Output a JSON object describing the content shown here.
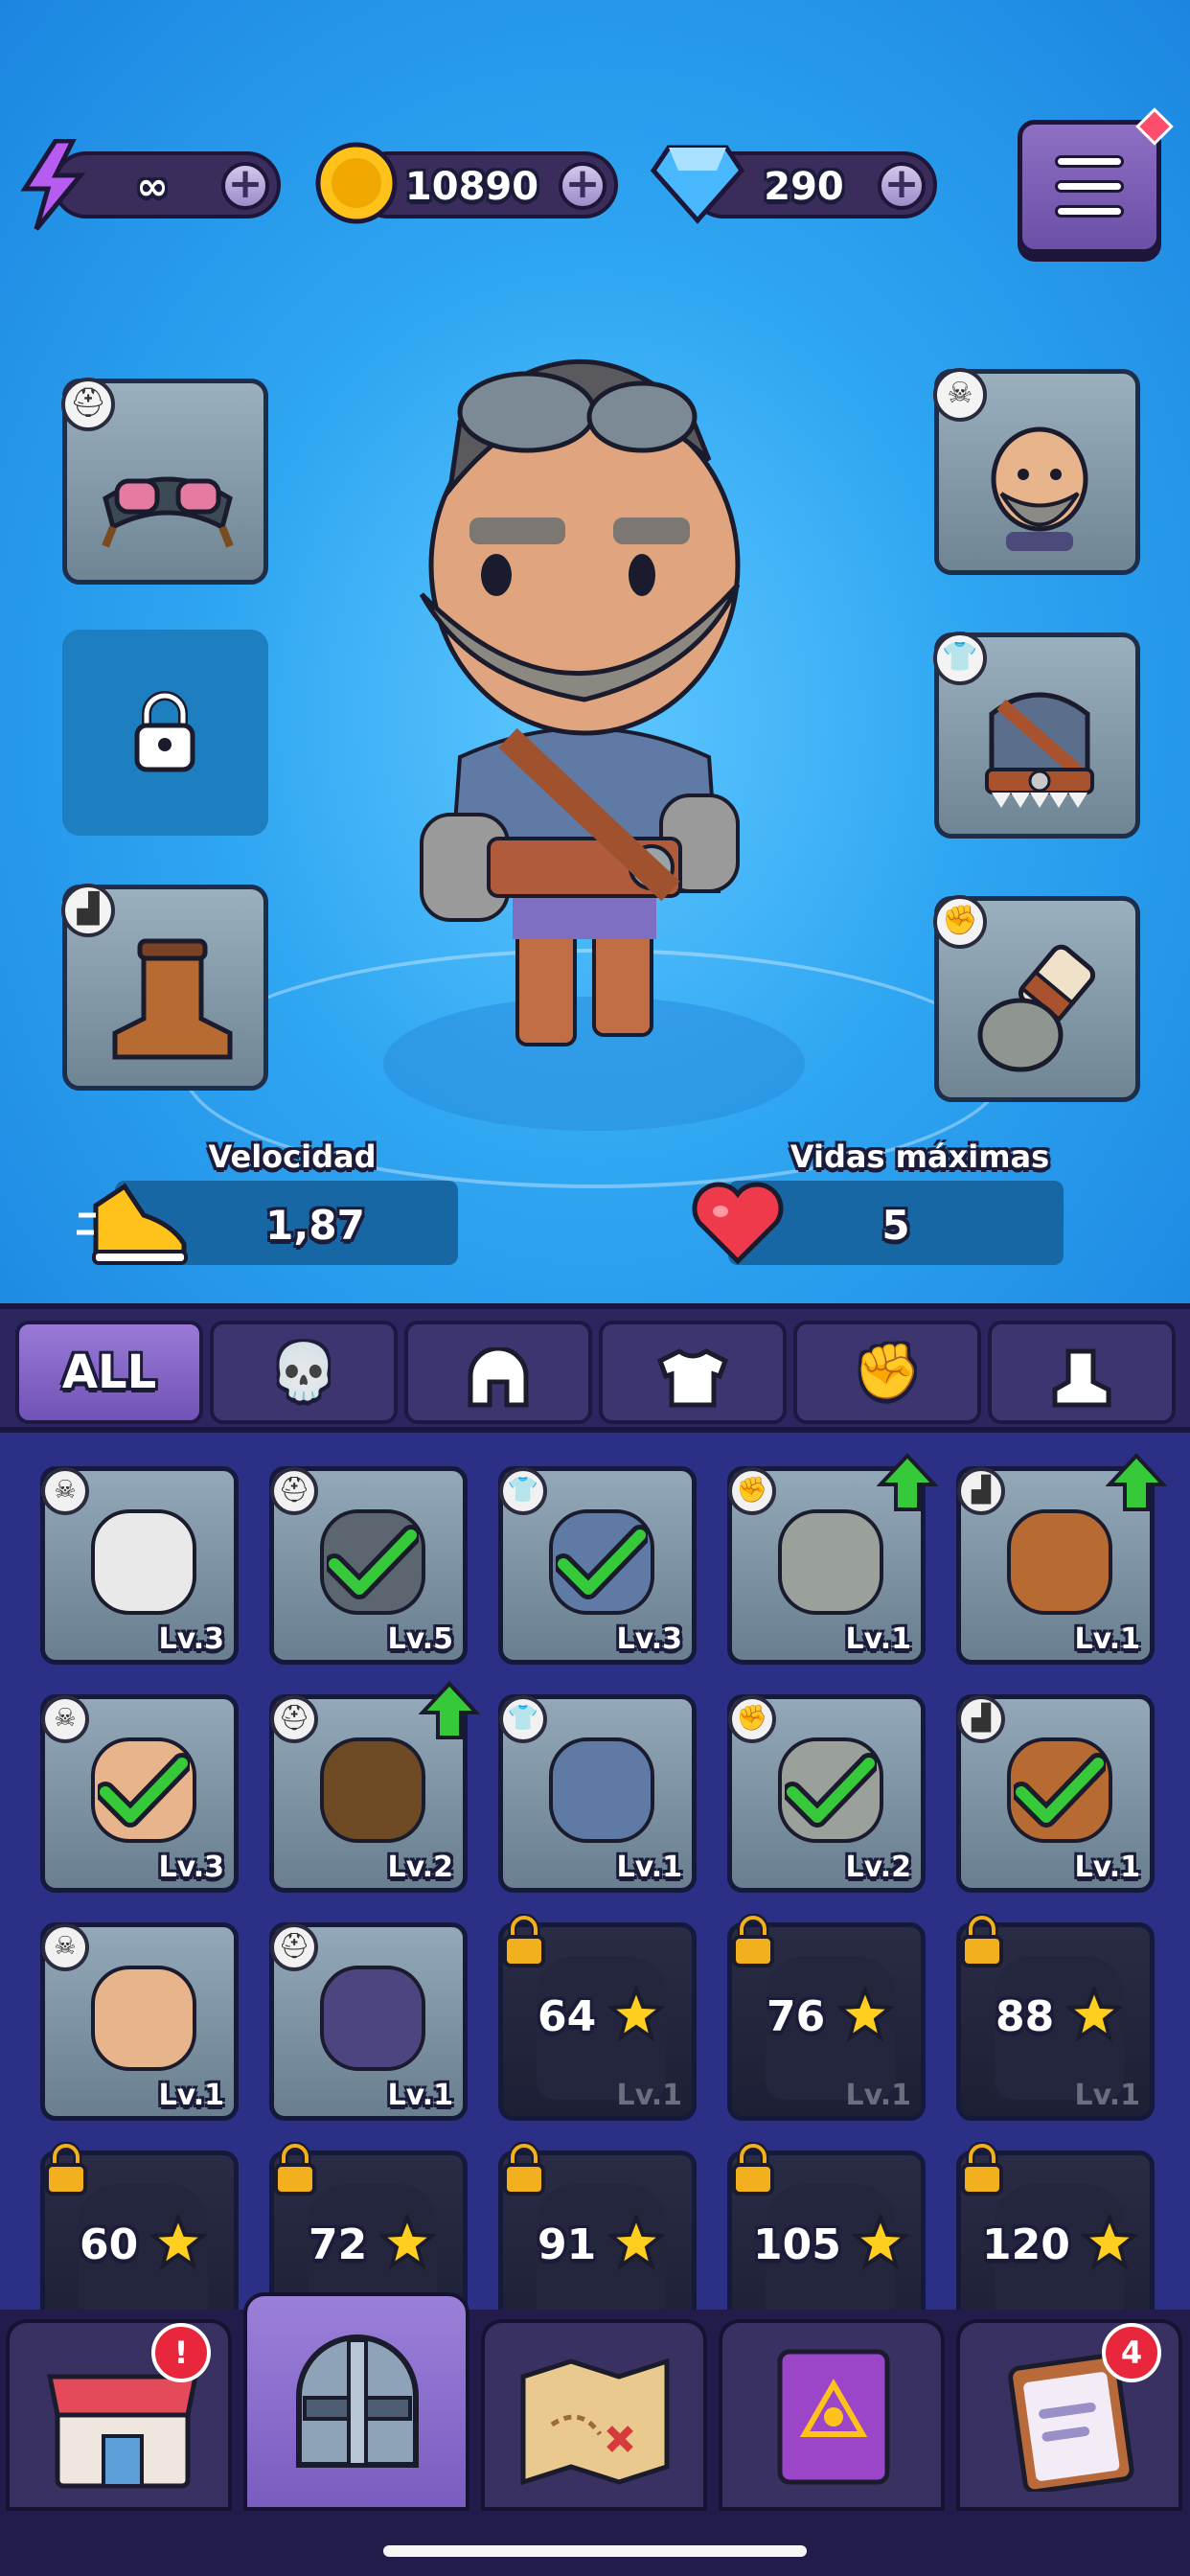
{
  "currencies": {
    "energy": {
      "icon": "lightning-icon",
      "value": "∞"
    },
    "coins": {
      "icon": "coin-icon",
      "value": "10890"
    },
    "gems": {
      "icon": "gem-icon",
      "value": "290"
    },
    "plus": "+"
  },
  "equipment_slots": {
    "left": [
      {
        "category": "helmet",
        "item": "goggles"
      },
      {
        "category": "locked",
        "item": "lock"
      },
      {
        "category": "boots",
        "item": "brown-boot"
      }
    ],
    "right": [
      {
        "category": "head",
        "item": "bald-bearded-face"
      },
      {
        "category": "armor",
        "item": "leather-vest"
      },
      {
        "category": "gloves",
        "item": "gauntlet"
      }
    ]
  },
  "stats": {
    "speed": {
      "label": "Velocidad",
      "value": "1,87",
      "icon": "sneaker-icon"
    },
    "lives": {
      "label": "Vidas máximas",
      "value": "5",
      "icon": "heart-icon"
    }
  },
  "tabs": [
    {
      "label": "ALL",
      "icon": "",
      "active": true
    },
    {
      "label": "",
      "icon": "skull-icon"
    },
    {
      "label": "",
      "icon": "helmet-icon"
    },
    {
      "label": "",
      "icon": "armor-icon"
    },
    {
      "label": "",
      "icon": "fist-icon"
    },
    {
      "label": "",
      "icon": "boot-icon"
    }
  ],
  "inventory": [
    {
      "cat": "skull",
      "name": "skull",
      "level": "Lv.3",
      "equipped": false,
      "upgrade": false
    },
    {
      "cat": "helmet",
      "name": "goggles",
      "level": "Lv.5",
      "equipped": true,
      "upgrade": false
    },
    {
      "cat": "armor",
      "name": "leather-vest",
      "level": "Lv.3",
      "equipped": true,
      "upgrade": false
    },
    {
      "cat": "fist",
      "name": "gauntlet",
      "level": "Lv.1",
      "equipped": false,
      "upgrade": true
    },
    {
      "cat": "boot",
      "name": "boot",
      "level": "Lv.1",
      "equipped": false,
      "upgrade": true
    },
    {
      "cat": "skull",
      "name": "bald-face",
      "level": "Lv.3",
      "equipped": true,
      "upgrade": false
    },
    {
      "cat": "helmet",
      "name": "bear-hood",
      "level": "Lv.2",
      "equipped": false,
      "upgrade": true
    },
    {
      "cat": "armor",
      "name": "tool-vest",
      "level": "Lv.1",
      "equipped": false,
      "upgrade": false
    },
    {
      "cat": "fist",
      "name": "gauntlet",
      "level": "Lv.2",
      "equipped": true,
      "upgrade": false
    },
    {
      "cat": "boot",
      "name": "boot",
      "level": "Lv.1",
      "equipped": true,
      "upgrade": false
    },
    {
      "cat": "skull",
      "name": "dark-hair-face",
      "level": "Lv.1",
      "equipped": false,
      "upgrade": false
    },
    {
      "cat": "helmet",
      "name": "purple-hood",
      "level": "Lv.1",
      "equipped": false,
      "upgrade": false
    },
    {
      "cat": "armor",
      "name": "locked-armor",
      "level": "Lv.1",
      "locked": true,
      "cost": "64"
    },
    {
      "cat": "fist",
      "name": "locked-glove",
      "level": "Lv.1",
      "locked": true,
      "cost": "76"
    },
    {
      "cat": "boot",
      "name": "locked-boot",
      "level": "Lv.1",
      "locked": true,
      "cost": "88"
    },
    {
      "cat": "skull",
      "name": "locked-antler",
      "level": "",
      "locked": true,
      "cost": "60"
    },
    {
      "cat": "helmet",
      "name": "locked-horned",
      "level": "",
      "locked": true,
      "cost": "72"
    },
    {
      "cat": "armor",
      "name": "locked-armor-2",
      "level": "",
      "locked": true,
      "cost": "91"
    },
    {
      "cat": "fist",
      "name": "locked-glove-2",
      "level": "",
      "locked": true,
      "cost": "105"
    },
    {
      "cat": "boot",
      "name": "locked-boot-2",
      "level": "",
      "locked": true,
      "cost": "120"
    }
  ],
  "bottom_nav": [
    {
      "name": "shop",
      "icon": "shop-icon",
      "badge": "!"
    },
    {
      "name": "equipment",
      "icon": "helmet-icon",
      "badge": "",
      "active": true
    },
    {
      "name": "map",
      "icon": "map-icon",
      "badge": ""
    },
    {
      "name": "spellbook",
      "icon": "book-icon",
      "badge": ""
    },
    {
      "name": "quests",
      "icon": "clipboard-icon",
      "badge": "4"
    }
  ],
  "colors": {
    "sky": "#2fa6f2",
    "panel": "#2c2f86",
    "tab_active": "#7152b7",
    "check": "#36c93a",
    "star": "#ffcf1f",
    "badge": "#e8273c"
  }
}
